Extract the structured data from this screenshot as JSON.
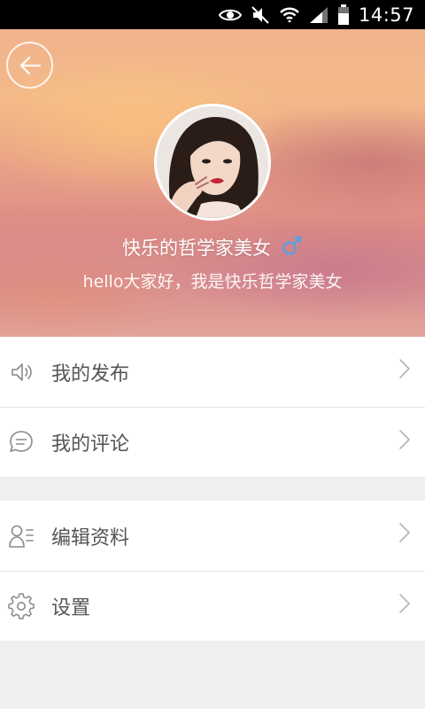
{
  "status_bar": {
    "time": "14:57",
    "icons": [
      "eye-icon",
      "mute-icon",
      "wifi-icon",
      "signal-icon",
      "battery-icon"
    ]
  },
  "profile": {
    "back_icon": "arrow-left-icon",
    "name": "快乐的哲学家美女",
    "gender_icon": "male-icon",
    "bio": "hello大家好，我是快乐哲学家美女"
  },
  "menu_groups": [
    {
      "items": [
        {
          "icon": "speaker-icon",
          "label": "我的发布"
        },
        {
          "icon": "comment-icon",
          "label": "我的评论"
        }
      ]
    },
    {
      "items": [
        {
          "icon": "profile-edit-icon",
          "label": "编辑资料"
        },
        {
          "icon": "gear-icon",
          "label": "设置"
        }
      ]
    }
  ],
  "colors": {
    "gender_icon": "#5aa0e0",
    "separator_background": "#efefef",
    "label_text": "#555555",
    "icon_stroke": "#8a8a8a"
  }
}
